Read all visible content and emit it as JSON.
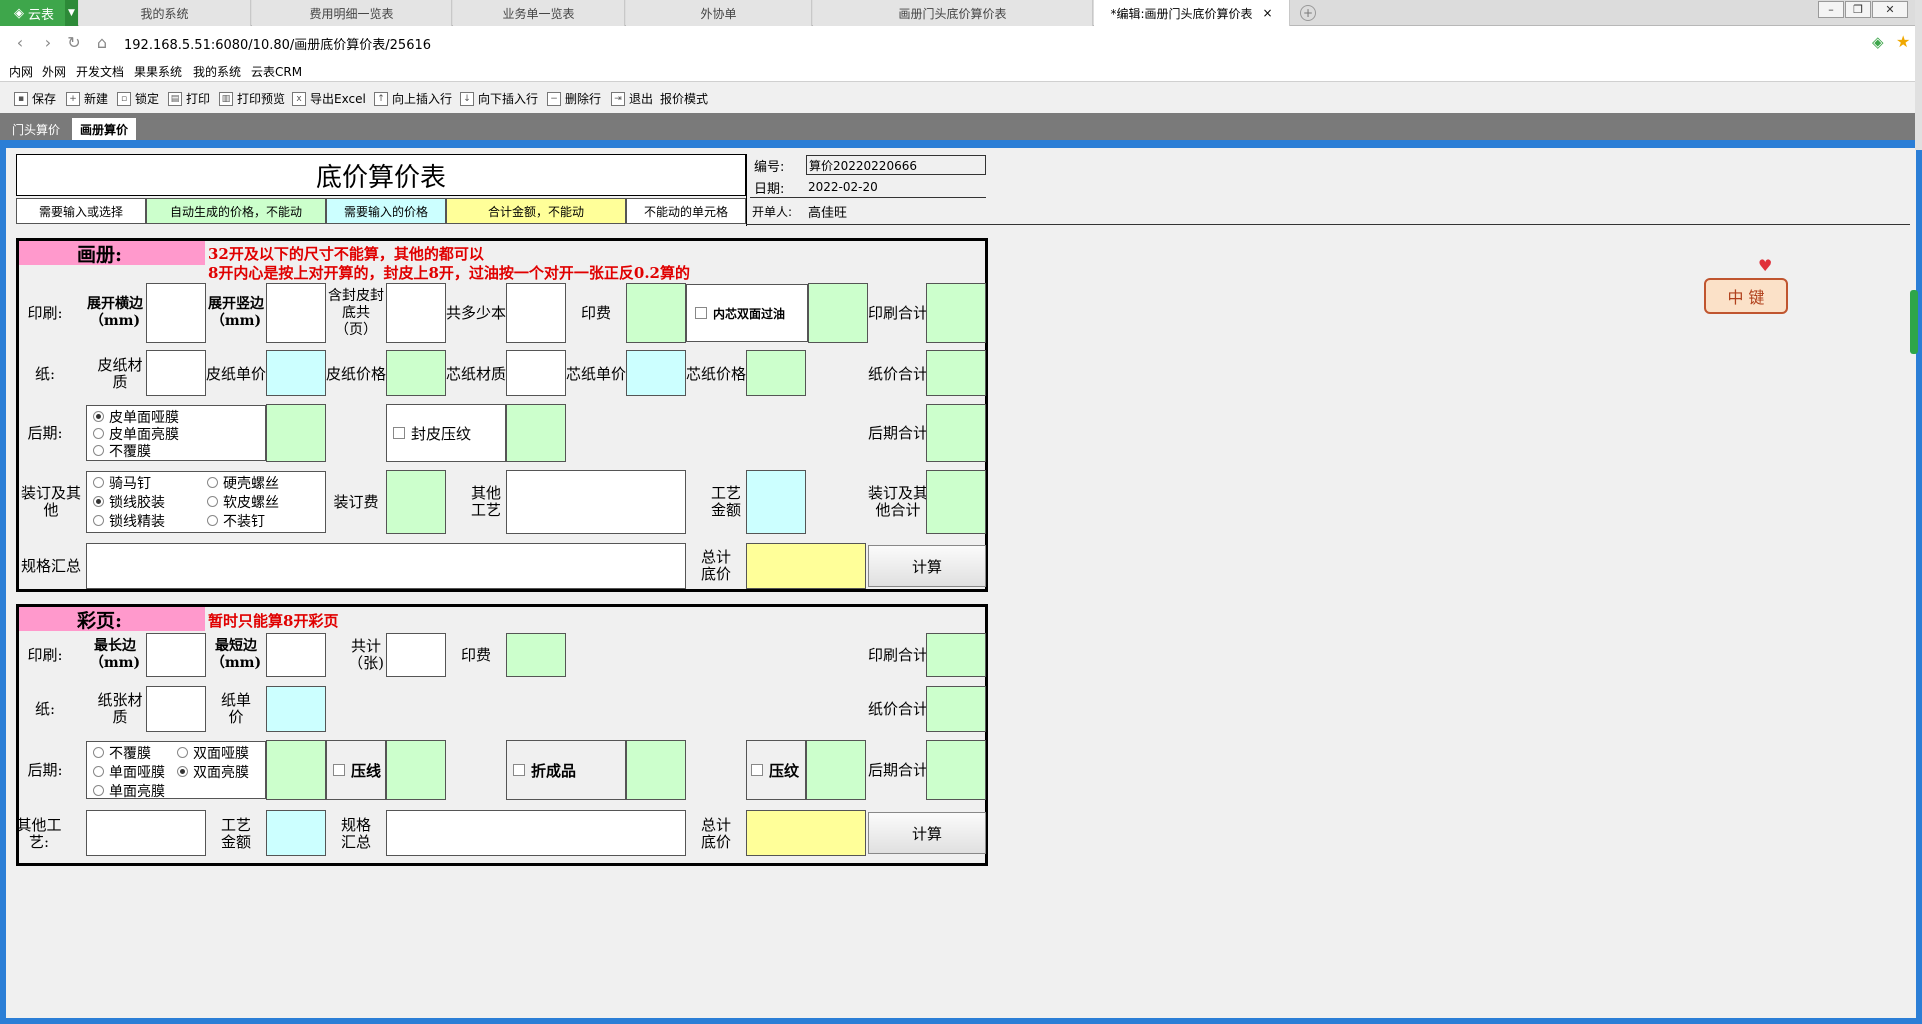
{
  "browser": {
    "app_name": "云表",
    "tabs": [
      {
        "label": "我的系统"
      },
      {
        "label": "费用明细一览表"
      },
      {
        "label": "业务单一览表"
      },
      {
        "label": "外协单"
      },
      {
        "label": "画册门头底价算价表"
      },
      {
        "label": "*编辑:画册门头底价算价表"
      }
    ],
    "url": "192.168.5.51:6080/10.80/画册底价算价表/25616",
    "bookmarks": [
      "内网",
      "外网",
      "开发文档",
      "果果系统",
      "我的系统",
      "云表CRM"
    ]
  },
  "toolbar": {
    "items": [
      "保存",
      "新建",
      "锁定",
      "打印",
      "打印预览",
      "导出Excel",
      "向上插入行",
      "向下插入行",
      "删除行",
      "退出",
      "报价模式"
    ]
  },
  "sheet_tabs": [
    "门头算价",
    "画册算价"
  ],
  "form": {
    "title": "底价算价表",
    "number_label": "编号:",
    "number_value": "算价20220220666",
    "date_label": "日期:",
    "date_value": "2022-02-20",
    "creator_label": "开单人:",
    "creator_value": "高佳旺",
    "legend": [
      "需要输入或选择",
      "自动生成的价格，不能动",
      "需要输入的价格",
      "合计金额，不能动",
      "不能动的单元格"
    ]
  },
  "album": {
    "header": "画册:",
    "note1": "32开及以下的尺寸不能算，其他的都可以",
    "note2": "8开内心是按上对开算的，封皮上8开，过油按一个对开一张正反0.2算的",
    "print_label": "印刷:",
    "unfold_w": "展开横边（mm)",
    "unfold_h": "展开竖边（mm)",
    "pages": "含封皮封底共（页）",
    "copies": "共多少本",
    "print_fee": "印费",
    "inner_oil": "内芯双面过油",
    "print_total": "印刷合计",
    "paper_label": "纸:",
    "cover_material": "皮纸材质",
    "cover_unit": "皮纸单价",
    "cover_price": "皮纸价格",
    "core_material": "芯纸材质",
    "core_unit": "芯纸单价",
    "core_price": "芯纸价格",
    "paper_total": "纸价合计",
    "post_label": "后期:",
    "lamination": [
      "皮单面哑膜",
      "皮单面亮膜",
      "不覆膜"
    ],
    "cover_emboss": "封皮压纹",
    "post_total": "后期合计",
    "binding_label": "装订及其他",
    "binding_opts": [
      "骑马钉",
      "硬壳螺丝",
      "锁线胶装",
      "软皮螺丝",
      "锁线精装",
      "不装钉"
    ],
    "binding_fee": "装订费",
    "other_craft": "其他工艺",
    "craft_amount": "工艺金额",
    "binding_total": "装订及其他合计",
    "spec_summary": "规格汇总",
    "total_price": "总计底价",
    "calc": "计算"
  },
  "colorpage": {
    "header": "彩页:",
    "note": "暂时只能算8开彩页",
    "print_label": "印刷:",
    "long_edge": "最长边（mm)",
    "short_edge": "最短边（mm)",
    "count": "共计（张)",
    "print_fee": "印费",
    "print_total": "印刷合计",
    "paper_label": "纸:",
    "paper_material": "纸张材质",
    "paper_unit": "纸单价",
    "paper_total": "纸价合计",
    "post_label": "后期:",
    "lamination": [
      "不覆膜",
      "双面哑膜",
      "单面哑膜",
      "双面亮膜",
      "单面亮膜"
    ],
    "crease": "压线",
    "fold": "折成品",
    "emboss": "压纹",
    "post_total": "后期合计",
    "other_craft": "其他工艺:",
    "craft_amount": "工艺金额",
    "spec_summary": "规格汇总",
    "total_price": "总计底价",
    "calc": "计算"
  },
  "ime": {
    "label": "中 键"
  }
}
